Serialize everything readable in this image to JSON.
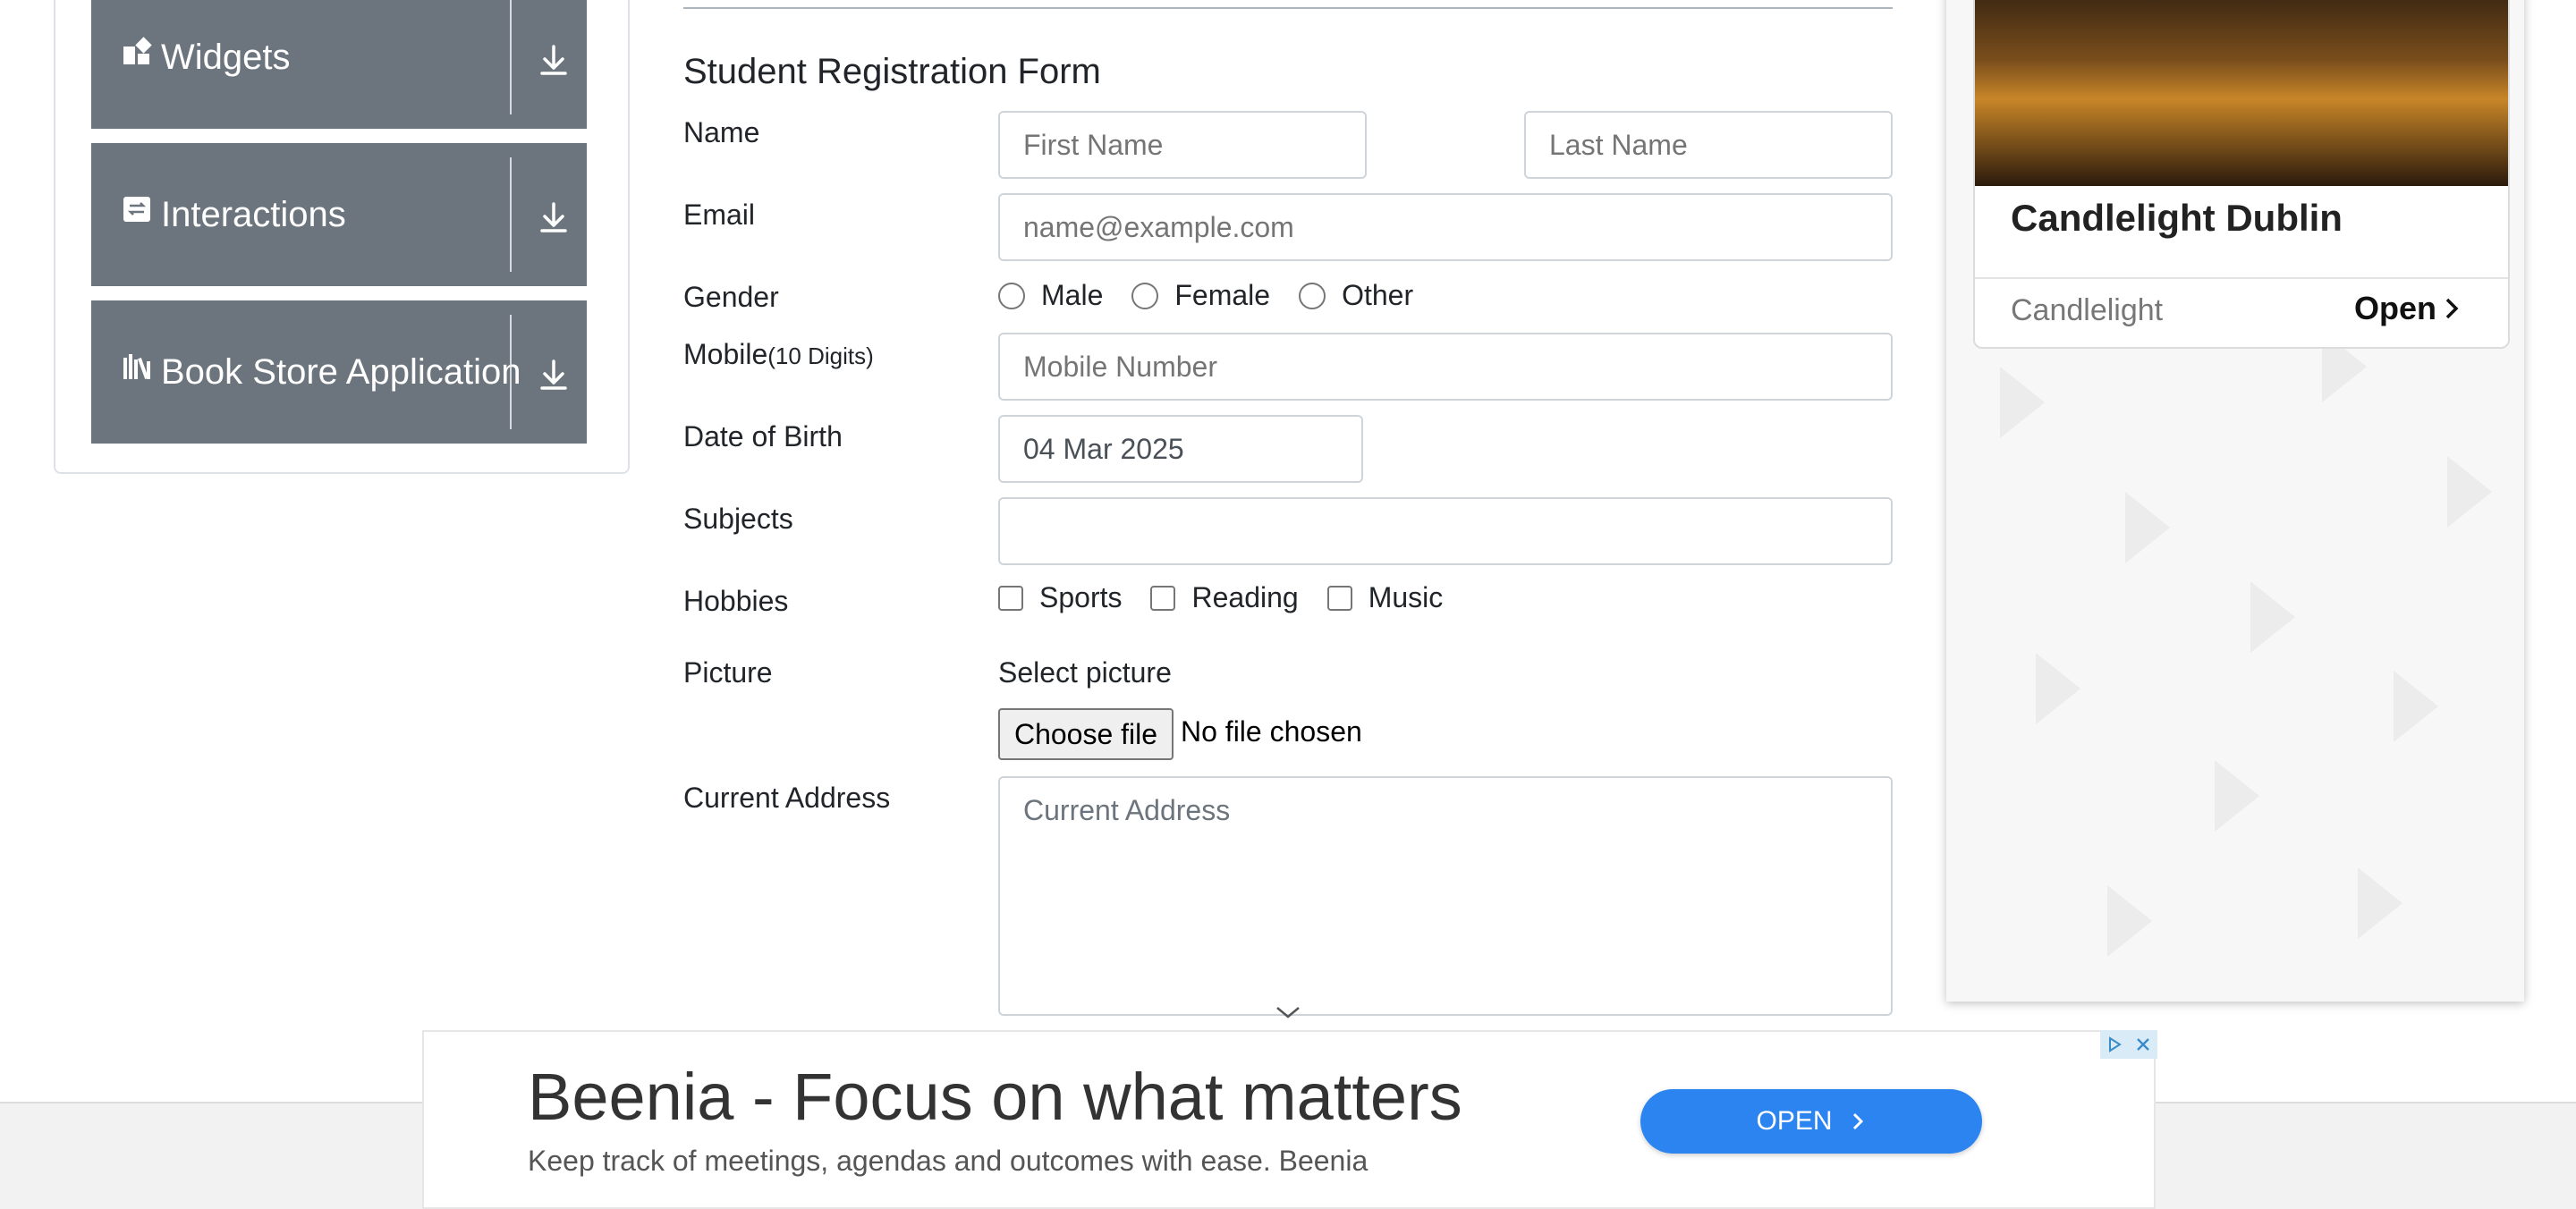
{
  "sidebar": {
    "groups": [
      {
        "label": "Widgets",
        "icon": "widgets-icon"
      },
      {
        "label": "Interactions",
        "icon": "interactions-icon"
      },
      {
        "label": "Book Store Application",
        "icon": "book-store-icon"
      }
    ]
  },
  "form": {
    "title": "Student Registration Form",
    "name_label": "Name",
    "first_name_placeholder": "First Name",
    "last_name_placeholder": "Last Name",
    "email_label": "Email",
    "email_placeholder": "name@example.com",
    "gender_label": "Gender",
    "gender_options": [
      "Male",
      "Female",
      "Other"
    ],
    "mobile_label": "Mobile",
    "mobile_hint": "(10 Digits)",
    "mobile_placeholder": "Mobile Number",
    "dob_label": "Date of Birth",
    "dob_value": "04 Mar 2025",
    "subjects_label": "Subjects",
    "hobbies_label": "Hobbies",
    "hobby_options": [
      "Sports",
      "Reading",
      "Music"
    ],
    "picture_label": "Picture",
    "picture_prompt": "Select picture",
    "choose_file_label": "Choose file",
    "no_file_text": "No file chosen",
    "address_label": "Current Address",
    "address_placeholder": "Current Address"
  },
  "side_ad": {
    "title": "Candlelight Dublin",
    "brand": "Candlelight",
    "open_label": "Open"
  },
  "bottom_ad": {
    "title": "Beenia - Focus on what matters",
    "subtitle": "Keep track of meetings, agendas and outcomes with ease. Beenia",
    "button_label": "OPEN"
  },
  "colors": {
    "menu_bg": "#6c757d",
    "input_border": "#ced4da",
    "ad_button": "#2b84f0"
  }
}
